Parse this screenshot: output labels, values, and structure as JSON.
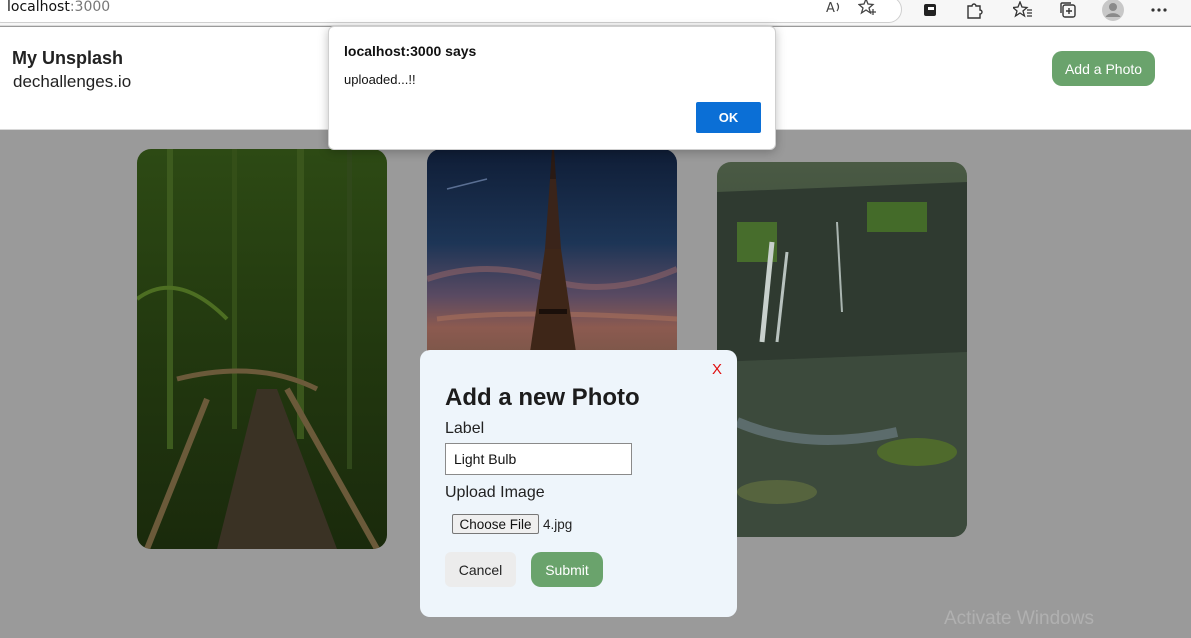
{
  "browser": {
    "url_host": "localhost",
    "url_port": ":3000"
  },
  "header": {
    "title": "My Unsplash",
    "subtitle": "dechallenges.io",
    "add_button": "Add a Photo"
  },
  "modal": {
    "close_label": "X",
    "title": "Add a new Photo",
    "label_field_label": "Label",
    "label_value": "Light Bulb",
    "upload_label": "Upload Image",
    "file_button": "Choose File",
    "file_name": "4.jpg",
    "cancel": "Cancel",
    "submit": "Submit"
  },
  "alert": {
    "title": "localhost:3000 says",
    "message": "uploaded...!!",
    "ok": "OK"
  },
  "watermark": "Activate Windows",
  "colors": {
    "accent_green": "#6aa36c",
    "alert_ok_blue": "#0b6fd6",
    "close_red": "#e01010",
    "overlay_gray": "#9a9a9a"
  },
  "icons": [
    "read-aloud-icon",
    "favorite-add-icon",
    "collections-icon",
    "extensions-icon",
    "favorites-icon",
    "tab-actions-icon",
    "profile-icon",
    "more-icon"
  ]
}
